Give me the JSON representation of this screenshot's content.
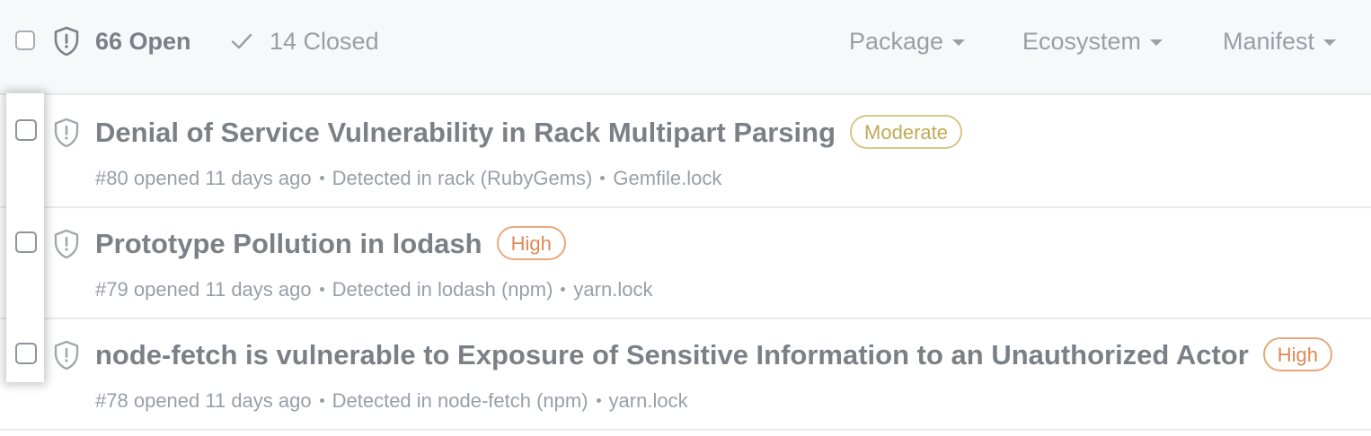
{
  "header": {
    "open_label": "66 Open",
    "closed_label": "14 Closed",
    "filters": [
      "Package",
      "Ecosystem",
      "Manifest"
    ]
  },
  "alerts": [
    {
      "title": "Denial of Service Vulnerability in Rack Multipart Parsing",
      "severity": "Moderate",
      "number": "#80",
      "opened": "opened 11 days ago",
      "detected": "Detected in rack (RubyGems)",
      "manifest": "Gemfile.lock"
    },
    {
      "title": "Prototype Pollution in lodash",
      "severity": "High",
      "number": "#79",
      "opened": "opened 11 days ago",
      "detected": "Detected in lodash (npm)",
      "manifest": "yarn.lock"
    },
    {
      "title": "node-fetch is vulnerable to Exposure of Sensitive Information to an Unauthorized Actor",
      "severity": "High",
      "number": "#78",
      "opened": "opened 11 days ago",
      "detected": "Detected in node-fetch (npm)",
      "manifest": "yarn.lock"
    }
  ],
  "colors": {
    "moderate": "#c3a955",
    "high": "#dd8a55",
    "text": "#7b8087"
  },
  "icons": [
    "shield-alert-icon",
    "check-icon",
    "caret-down-icon"
  ]
}
